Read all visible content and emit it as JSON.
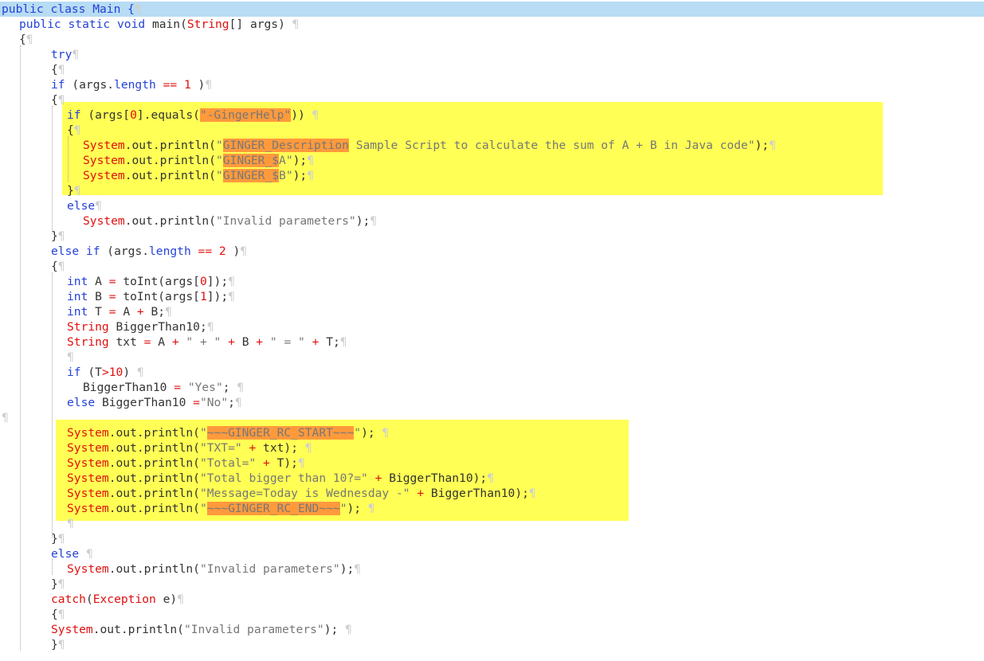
{
  "editor": {
    "language": "java",
    "pilcrow": "¶",
    "colors": {
      "keyword": "#2442d8",
      "class_or_number": "#e01010",
      "string": "#777777",
      "default": "#333333",
      "current_line": "#b7dcf3",
      "block_highlight": "#ffff55",
      "search_match": "#ff9a3c"
    },
    "lines": [
      {
        "indent": 0,
        "current": true,
        "t": [
          [
            "kw",
            "public class Main {"
          ]
        ]
      },
      {
        "indent": 1,
        "t": [
          [
            "kw",
            "public static void "
          ],
          [
            "",
            "main("
          ],
          [
            "cls",
            "String"
          ],
          [
            "",
            "[] args) "
          ]
        ]
      },
      {
        "indent": 1,
        "t": [
          [
            "",
            "{"
          ]
        ]
      },
      {
        "indent": 3,
        "t": [
          [
            "kw",
            "try"
          ]
        ]
      },
      {
        "indent": 3,
        "t": [
          [
            "",
            "{"
          ]
        ]
      },
      {
        "indent": 3,
        "t": [
          [
            "kw",
            "if "
          ],
          [
            "",
            "(args."
          ],
          [
            "kw",
            "length "
          ],
          [
            "op",
            "=="
          ],
          [
            "num",
            " 1"
          ],
          [
            "",
            " )"
          ]
        ]
      },
      {
        "indent": 3,
        "t": [
          [
            "",
            "{"
          ]
        ]
      },
      {
        "indent": 4,
        "t": [
          [
            "kw",
            "if "
          ],
          [
            "",
            "(args["
          ],
          [
            "num",
            "0"
          ],
          [
            "",
            "].equals("
          ],
          [
            "str,mark",
            "\"-GingerHelp\""
          ],
          [
            "",
            ")) "
          ]
        ]
      },
      {
        "indent": 4,
        "t": [
          [
            "",
            "{"
          ]
        ]
      },
      {
        "indent": 5,
        "t": [
          [
            "cls",
            "System"
          ],
          [
            "",
            ".out.println("
          ],
          [
            "str",
            "\""
          ],
          [
            "str,mark",
            "GINGER_Description"
          ],
          [
            "str",
            " Sample Script to calculate the sum of A + B in Java code\""
          ],
          [
            "",
            ");"
          ]
        ]
      },
      {
        "indent": 5,
        "t": [
          [
            "cls",
            "System"
          ],
          [
            "",
            ".out.println("
          ],
          [
            "str",
            "\""
          ],
          [
            "str,mark",
            "GINGER_$"
          ],
          [
            "str",
            "A\""
          ],
          [
            "",
            ");"
          ]
        ]
      },
      {
        "indent": 5,
        "t": [
          [
            "cls",
            "System"
          ],
          [
            "",
            ".out.println("
          ],
          [
            "str",
            "\""
          ],
          [
            "str,mark",
            "GINGER_$"
          ],
          [
            "str",
            "B\""
          ],
          [
            "",
            ");"
          ]
        ]
      },
      {
        "indent": 4,
        "t": [
          [
            "",
            "}"
          ]
        ]
      },
      {
        "indent": 4,
        "t": [
          [
            "kw",
            "else"
          ]
        ]
      },
      {
        "indent": 5,
        "t": [
          [
            "cls",
            "System"
          ],
          [
            "",
            ".out.println("
          ],
          [
            "str",
            "\"Invalid parameters\""
          ],
          [
            "",
            ");"
          ]
        ]
      },
      {
        "indent": 3,
        "t": [
          [
            "",
            "}"
          ]
        ]
      },
      {
        "indent": 3,
        "t": [
          [
            "kw",
            "else if "
          ],
          [
            "",
            "(args."
          ],
          [
            "kw",
            "length "
          ],
          [
            "op",
            "=="
          ],
          [
            "num",
            " 2"
          ],
          [
            "",
            " )"
          ]
        ]
      },
      {
        "indent": 3,
        "t": [
          [
            "",
            "{"
          ]
        ]
      },
      {
        "indent": 4,
        "t": [
          [
            "kw",
            "int "
          ],
          [
            "",
            "A "
          ],
          [
            "op",
            "="
          ],
          [
            "",
            " toInt(args["
          ],
          [
            "num",
            "0"
          ],
          [
            "",
            "]);"
          ]
        ]
      },
      {
        "indent": 4,
        "t": [
          [
            "kw",
            "int "
          ],
          [
            "",
            "B "
          ],
          [
            "op",
            "="
          ],
          [
            "",
            " toInt(args["
          ],
          [
            "num",
            "1"
          ],
          [
            "",
            "]);"
          ]
        ]
      },
      {
        "indent": 4,
        "t": [
          [
            "kw",
            "int "
          ],
          [
            "",
            "T "
          ],
          [
            "op",
            "="
          ],
          [
            "",
            " A "
          ],
          [
            "op",
            "+"
          ],
          [
            "",
            " B;"
          ]
        ]
      },
      {
        "indent": 4,
        "t": [
          [
            "cls",
            "String "
          ],
          [
            "",
            "BiggerThan10;"
          ]
        ]
      },
      {
        "indent": 4,
        "t": [
          [
            "cls",
            "String "
          ],
          [
            "",
            "txt "
          ],
          [
            "op",
            "="
          ],
          [
            "",
            " A "
          ],
          [
            "op",
            "+"
          ],
          [
            "str",
            " \" + \" "
          ],
          [
            "op",
            "+"
          ],
          [
            "",
            " B "
          ],
          [
            "op",
            "+"
          ],
          [
            "str",
            " \" = \" "
          ],
          [
            "op",
            "+"
          ],
          [
            "",
            " T;"
          ]
        ]
      },
      {
        "indent": 4,
        "t": []
      },
      {
        "indent": 4,
        "t": [
          [
            "kw",
            "if "
          ],
          [
            "",
            "(T"
          ],
          [
            "op",
            ">"
          ],
          [
            "num",
            "10"
          ],
          [
            "",
            ") "
          ]
        ]
      },
      {
        "indent": 5,
        "t": [
          [
            "",
            "BiggerThan10 "
          ],
          [
            "op",
            "="
          ],
          [
            "str",
            " \"Yes\""
          ],
          [
            "",
            "; "
          ]
        ]
      },
      {
        "indent": 4,
        "t": [
          [
            "kw",
            "else "
          ],
          [
            "",
            "BiggerThan10 "
          ],
          [
            "op",
            "="
          ],
          [
            "str",
            "\"No\""
          ],
          [
            "",
            ";"
          ]
        ]
      },
      {
        "indent": 0,
        "t": []
      },
      {
        "indent": 4,
        "t": [
          [
            "cls",
            "System"
          ],
          [
            "",
            ".out.println("
          ],
          [
            "str",
            "\""
          ],
          [
            "str,mark",
            "~~~GINGER_RC_START~~~"
          ],
          [
            "str",
            "\""
          ],
          [
            "",
            "); "
          ]
        ]
      },
      {
        "indent": 4,
        "t": [
          [
            "cls",
            "System"
          ],
          [
            "",
            ".out.println("
          ],
          [
            "str",
            "\"TXT=\" "
          ],
          [
            "op",
            "+"
          ],
          [
            "",
            " txt); "
          ]
        ]
      },
      {
        "indent": 4,
        "t": [
          [
            "cls",
            "System"
          ],
          [
            "",
            ".out.println("
          ],
          [
            "str",
            "\"Total=\" "
          ],
          [
            "op",
            "+"
          ],
          [
            "",
            " T);"
          ]
        ]
      },
      {
        "indent": 4,
        "t": [
          [
            "cls",
            "System"
          ],
          [
            "",
            ".out.println("
          ],
          [
            "str",
            "\"Total bigger than 10?=\" "
          ],
          [
            "op",
            "+"
          ],
          [
            "",
            " BiggerThan10);"
          ]
        ]
      },
      {
        "indent": 4,
        "t": [
          [
            "cls",
            "System"
          ],
          [
            "",
            ".out.println("
          ],
          [
            "str",
            "\"Message=Today is Wednesday -\" "
          ],
          [
            "op",
            "+"
          ],
          [
            "",
            " BiggerThan10);"
          ]
        ]
      },
      {
        "indent": 4,
        "t": [
          [
            "cls",
            "System"
          ],
          [
            "",
            ".out.println("
          ],
          [
            "str",
            "\""
          ],
          [
            "str,mark",
            "~~~GINGER_RC_END~~~"
          ],
          [
            "str",
            "\""
          ],
          [
            "",
            "); "
          ]
        ]
      },
      {
        "indent": 4,
        "t": []
      },
      {
        "indent": 3,
        "t": [
          [
            "",
            "}"
          ]
        ]
      },
      {
        "indent": 3,
        "t": [
          [
            "kw",
            "else "
          ]
        ]
      },
      {
        "indent": 4,
        "t": [
          [
            "cls",
            "System"
          ],
          [
            "",
            ".out.println("
          ],
          [
            "str",
            "\"Invalid parameters\""
          ],
          [
            "",
            ");"
          ]
        ]
      },
      {
        "indent": 3,
        "t": [
          [
            "",
            "}"
          ]
        ]
      },
      {
        "indent": 3,
        "t": [
          [
            "cls",
            "catch"
          ],
          [
            "",
            "("
          ],
          [
            "cls",
            "Exception "
          ],
          [
            "",
            "e)"
          ]
        ]
      },
      {
        "indent": 3,
        "t": [
          [
            "",
            "{"
          ]
        ]
      },
      {
        "indent": 3,
        "t": [
          [
            "cls",
            "System"
          ],
          [
            "",
            ".out.println("
          ],
          [
            "str",
            "\"Invalid parameters\""
          ],
          [
            "",
            "); "
          ]
        ]
      },
      {
        "indent": 3,
        "t": [
          [
            "",
            "}"
          ]
        ]
      }
    ]
  }
}
